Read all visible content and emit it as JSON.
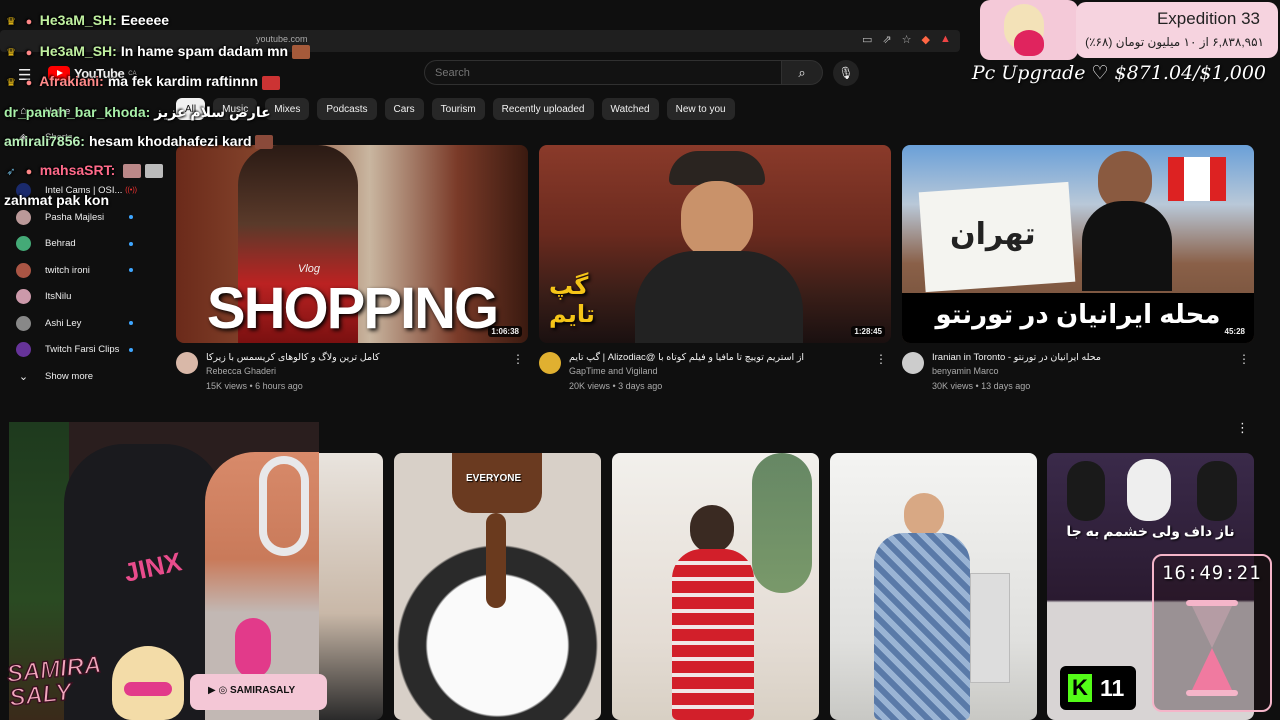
{
  "browser": {
    "url": "youtube.com"
  },
  "youtube": {
    "logo": "YouTube",
    "logo_country": "CA",
    "search_placeholder": "Search",
    "chips": [
      "All",
      "Music",
      "Mixes",
      "Podcasts",
      "Cars",
      "Tourism",
      "Recently uploaded",
      "Watched",
      "New to you"
    ],
    "sidebar": {
      "home": "Home",
      "shorts": "Shorts",
      "subscriptions": [
        {
          "name": "Intel Cams | OSI...",
          "color": "#1a2a6c",
          "live": true
        },
        {
          "name": "Pasha Majlesi",
          "color": "#b99"
        },
        {
          "name": "Behrad",
          "color": "#4a7"
        },
        {
          "name": "twitch ironi",
          "color": "#a54"
        },
        {
          "name": "ItsNilu",
          "color": "#c9a"
        },
        {
          "name": "Ashi Ley",
          "color": "#888"
        },
        {
          "name": "Twitch Farsi Clips",
          "color": "#639"
        }
      ],
      "show_more": "Show more"
    },
    "videos": [
      {
        "title": "کامل ترین ولاگ و کالوهای کریسمس با زیرکا",
        "channel": "Rebecca Ghaderi",
        "stats": "15K views • 6 hours ago",
        "duration": "1:06:38",
        "thumb_text": "SHOPPING",
        "thumb_small": "Vlog",
        "avatar_color": "#d9b8a8"
      },
      {
        "title": "از استریم توییچ تا مافیا و فیلم کوتاه با @Alizodiac | گپ تایم",
        "channel": "GapTime and Vigiland",
        "stats": "20K views • 3 days ago",
        "duration": "1:28:45",
        "thumb_text": "گپ تایم",
        "avatar_color": "#e0b030"
      },
      {
        "title": "Iranian in Toronto - محله ایرانیان در تورنتو",
        "channel": "benyamin Marco",
        "stats": "30K views • 13 days ago",
        "duration": "45:28",
        "thumb_text": "محله ایرانیان در تورنتو",
        "thumb_sign": "تهران",
        "avatar_color": "#ccc"
      }
    ],
    "shorts": [
      {
        "label": "EVERYONE"
      },
      {
        "label": ""
      },
      {
        "label": ""
      },
      {
        "label": "ناز داف ولی خشمم به جا"
      }
    ]
  },
  "chat": [
    {
      "badge": "crown",
      "user": "He3aM_SH:",
      "user_color": "#c0f0a0",
      "text": "Eeeeee"
    },
    {
      "badge": "crown",
      "user": "He3aM_SH:",
      "user_color": "#c0f0a0",
      "text": "In hame spam dadam mn"
    },
    {
      "badge": "crown",
      "user": "Afrakiani:",
      "user_color": "#ff8a8a",
      "text": "ma fek kardim raftinnn"
    },
    {
      "badge": "",
      "user": "dr_panah_bar_khoda:",
      "user_color": "#a8f0a8",
      "text": "عارض سلام عزیز"
    },
    {
      "badge": "",
      "user": "amirali7856:",
      "user_color": "#b8f0b8",
      "text": "hesam khodahafezi kard"
    },
    {
      "badge": "rocket",
      "user": "mahsaSRT:",
      "user_color": "#ff6a8a",
      "text": "zahmat pak kon"
    }
  ],
  "goal": {
    "title": "Expedition 33",
    "subtitle": "۶,۸۳۸,۹۵۱ از ۱۰ میلیون تومان (۶۸٪)",
    "upgrade": "Pc Upgrade ♡ $871.04/$1,000"
  },
  "streamer": {
    "name_line1": "SAMIRA",
    "name_line2": "SALY",
    "handle": "SAMIRASALY"
  },
  "timer": "16:49:21",
  "kick_count": "11"
}
